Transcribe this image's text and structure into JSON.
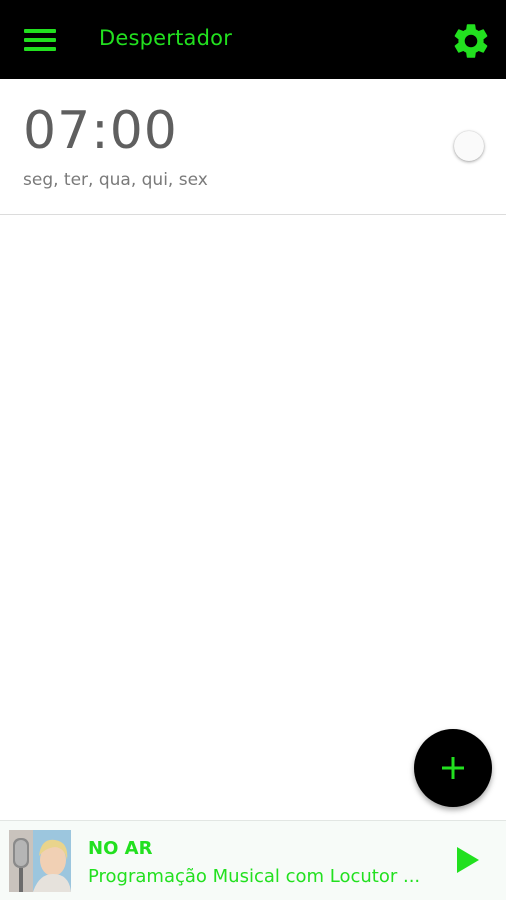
{
  "colors": {
    "accent": "#22e01f",
    "appbar_bg": "#000000",
    "time_text": "#5f5f5f"
  },
  "appbar": {
    "menu_icon": "hamburger-menu-icon",
    "title": "Despertador",
    "settings_icon": "gear-icon"
  },
  "alarms": [
    {
      "time": "07:00",
      "days": "seg, ter, qua, qui, sex",
      "enabled": false
    }
  ],
  "fab": {
    "icon": "plus-icon"
  },
  "player": {
    "status": "NO AR",
    "program": "Programação Musical com Locutor ...",
    "cover_icon": "announcer-photo",
    "play_icon": "play-icon"
  }
}
